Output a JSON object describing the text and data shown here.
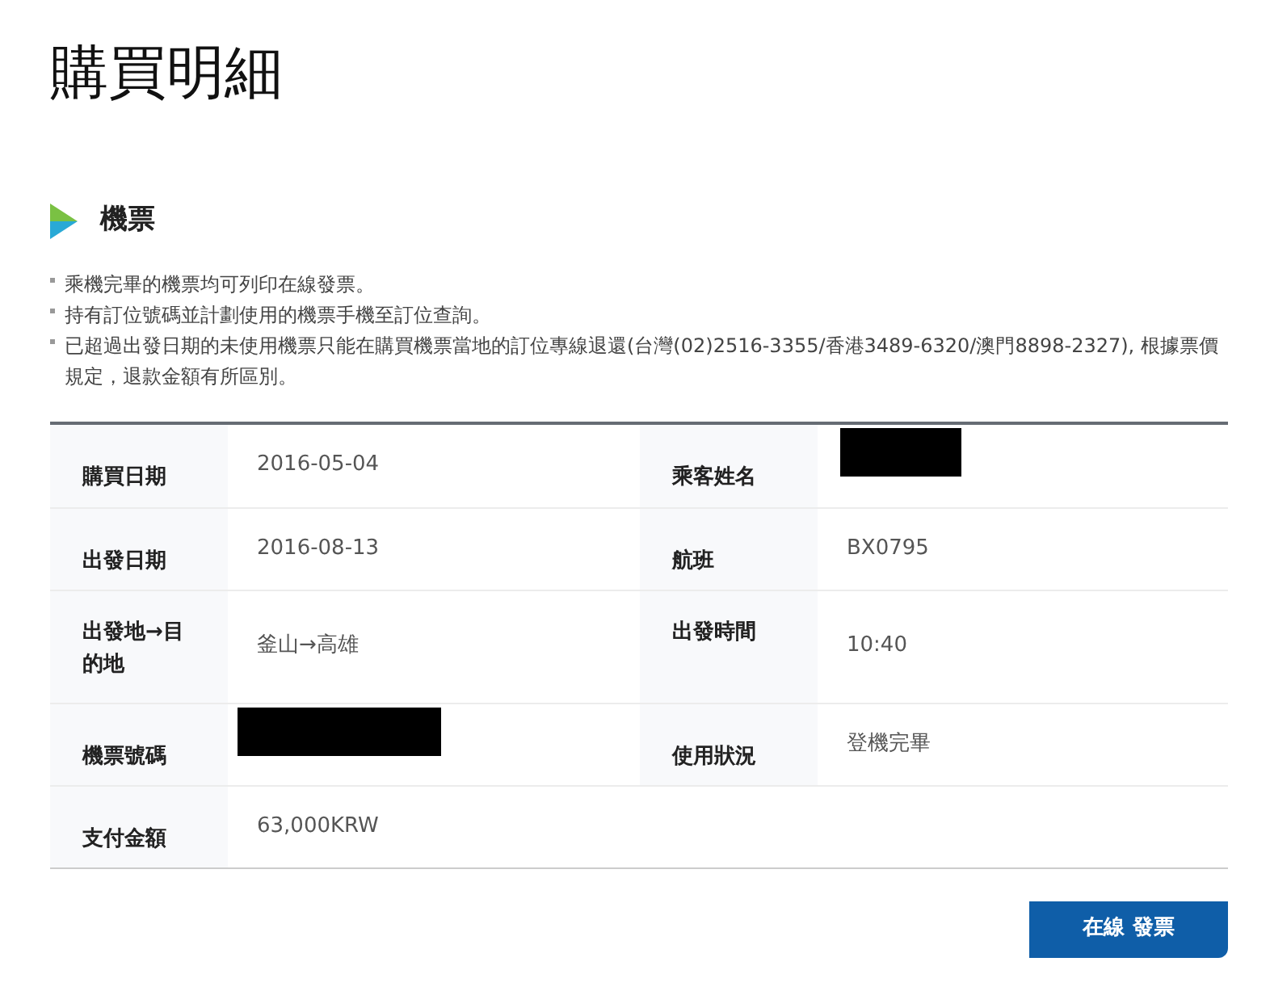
{
  "title": "購買明細",
  "section": {
    "title": "機票"
  },
  "notes": [
    "乘機完畢的機票均可列印在線發票。",
    "持有訂位號碼並計劃使用的機票手機至訂位查詢。",
    "已超過出發日期的未使用機票只能在購買機票當地的訂位專線退還(台灣(02)2516-3355/香港3489-6320/澳門8898-2327), 根據票價規定，退款金額有所區別。"
  ],
  "rows": [
    [
      {
        "label": "購買日期",
        "kind": "text",
        "value": "2016-05-04"
      },
      {
        "label": "乘客姓名",
        "kind": "redacted"
      }
    ],
    [
      {
        "label": "出發日期",
        "kind": "text",
        "value": "2016-08-13"
      },
      {
        "label": "航班",
        "kind": "text",
        "value": "BX0795"
      }
    ],
    [
      {
        "label": "出發地→目的地",
        "kind": "text",
        "value": "釜山→高雄"
      },
      {
        "label": "出發時間",
        "kind": "text",
        "value": "10:40"
      }
    ],
    [
      {
        "label": "機票號碼",
        "kind": "redacted"
      },
      {
        "label": "使用狀況",
        "kind": "text",
        "value": "登機完畢"
      }
    ],
    [
      {
        "label": "支付金額",
        "kind": "text",
        "value": "63,000KRW"
      }
    ]
  ],
  "button": "在線 發票"
}
